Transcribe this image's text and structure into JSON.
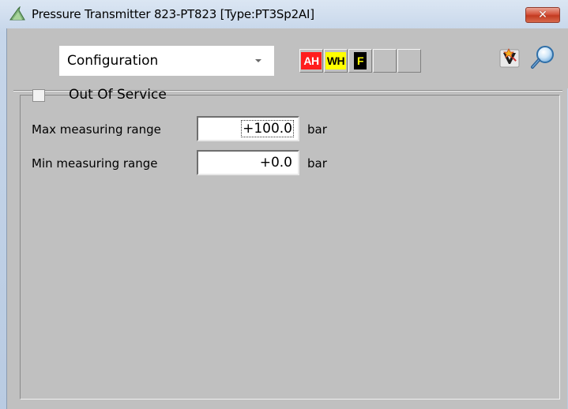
{
  "window": {
    "title": "Pressure Transmitter 823-PT823  [Type:PT3Sp2AI]",
    "close_glyph": "✕"
  },
  "toolbar": {
    "view_select": {
      "selected": "Configuration"
    },
    "alarms": [
      {
        "label": "AH",
        "color": "#ff1e1e"
      },
      {
        "label": "WH",
        "color": "#ffff00"
      },
      {
        "label": "F",
        "color": "#000000"
      },
      {
        "label": "",
        "color": ""
      },
      {
        "label": "",
        "color": ""
      }
    ],
    "tools": [
      {
        "icon": "maintenance-flag-icon"
      },
      {
        "icon": "magnifier-icon"
      }
    ]
  },
  "form": {
    "out_of_service": {
      "label": "Out Of Service",
      "checked": false
    },
    "max_range": {
      "label": "Max measuring range",
      "value": "+100.0",
      "unit": "bar"
    },
    "min_range": {
      "label": "Min measuring range",
      "value": "+0.0",
      "unit": "bar"
    }
  }
}
